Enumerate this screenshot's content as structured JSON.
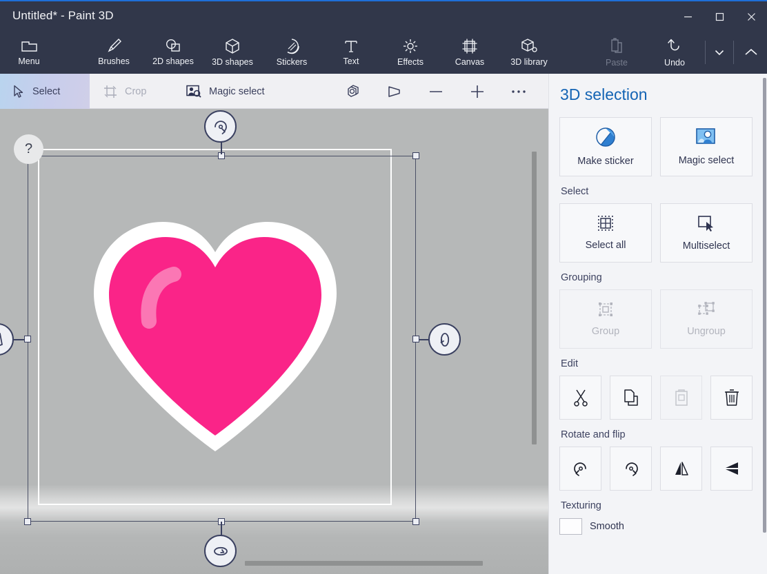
{
  "window": {
    "title": "Untitled* - Paint 3D",
    "controls": [
      {
        "name": "minimize",
        "glyph": "minimize-icon"
      },
      {
        "name": "maximize",
        "glyph": "maximize-icon"
      },
      {
        "name": "close",
        "glyph": "close-icon"
      }
    ]
  },
  "ribbon": {
    "items": [
      {
        "label": "Menu",
        "icon": "folder-icon"
      },
      {
        "label": "Brushes",
        "icon": "brush-icon"
      },
      {
        "label": "2D shapes",
        "icon": "2d-shapes-icon"
      },
      {
        "label": "3D shapes",
        "icon": "3d-shapes-icon"
      },
      {
        "label": "Stickers",
        "icon": "stickers-icon"
      },
      {
        "label": "Text",
        "icon": "text-icon"
      },
      {
        "label": "Effects",
        "icon": "effects-icon"
      },
      {
        "label": "Canvas",
        "icon": "canvas-icon"
      },
      {
        "label": "3D library",
        "icon": "3d-library-icon"
      }
    ],
    "right": [
      {
        "label": "Paste",
        "icon": "paste-icon",
        "disabled": true
      },
      {
        "label": "Undo",
        "icon": "undo-icon",
        "disabled": false
      }
    ],
    "dropdown_icon": "chevron-down-icon",
    "collapse_icon": "chevron-up-icon"
  },
  "toolbar": {
    "select_label": "Select",
    "crop_label": "Crop",
    "magic_select_label": "Magic select",
    "icons": [
      {
        "name": "3d-view-icon"
      },
      {
        "name": "perspective-view-icon"
      },
      {
        "name": "zoom-out-icon"
      },
      {
        "name": "zoom-in-icon"
      },
      {
        "name": "more-options-icon"
      }
    ]
  },
  "canvas": {
    "help_label": "?",
    "object": "heart-sticker",
    "heart_color": "#fa2488",
    "heart_outline_color": "#ffffff",
    "heart_highlight_color": "#fb77b4",
    "background_color": "#b6b8b8",
    "rotate_handles": [
      {
        "name": "rotate-x-handle",
        "position": "top"
      },
      {
        "name": "rotate-z-handle",
        "position": "right"
      },
      {
        "name": "rotate-y-handle",
        "position": "bottom"
      },
      {
        "name": "rotate-left-handle",
        "position": "left"
      }
    ]
  },
  "panel": {
    "title": "3D selection",
    "primary_tiles": [
      {
        "label": "Make sticker",
        "icon": "make-sticker-icon"
      },
      {
        "label": "Magic select",
        "icon": "magic-select-icon"
      }
    ],
    "sections": [
      {
        "label": "Select",
        "tiles": [
          {
            "label": "Select all",
            "icon": "select-all-icon",
            "disabled": false
          },
          {
            "label": "Multiselect",
            "icon": "multiselect-icon",
            "disabled": false
          }
        ]
      },
      {
        "label": "Grouping",
        "tiles": [
          {
            "label": "Group",
            "icon": "group-icon",
            "disabled": true
          },
          {
            "label": "Ungroup",
            "icon": "ungroup-icon",
            "disabled": true
          }
        ]
      }
    ],
    "edit": {
      "label": "Edit",
      "buttons": [
        {
          "name": "cut-icon",
          "disabled": false
        },
        {
          "name": "copy-icon",
          "disabled": false
        },
        {
          "name": "paste-icon",
          "disabled": true
        },
        {
          "name": "delete-icon",
          "disabled": false
        }
      ]
    },
    "rotate_flip": {
      "label": "Rotate and flip",
      "buttons": [
        {
          "name": "rotate-left-icon",
          "disabled": false
        },
        {
          "name": "rotate-right-icon",
          "disabled": false
        },
        {
          "name": "flip-horizontal-icon",
          "disabled": false
        },
        {
          "name": "flip-vertical-icon",
          "disabled": false
        }
      ]
    },
    "texturing": {
      "label": "Texturing",
      "checkbox_label": "Smooth"
    }
  },
  "colors": {
    "accent": "#1464b4",
    "titlebar": "#31374a",
    "panel_bg": "#f3f4f7",
    "active_tool": "#c4cfe9"
  }
}
